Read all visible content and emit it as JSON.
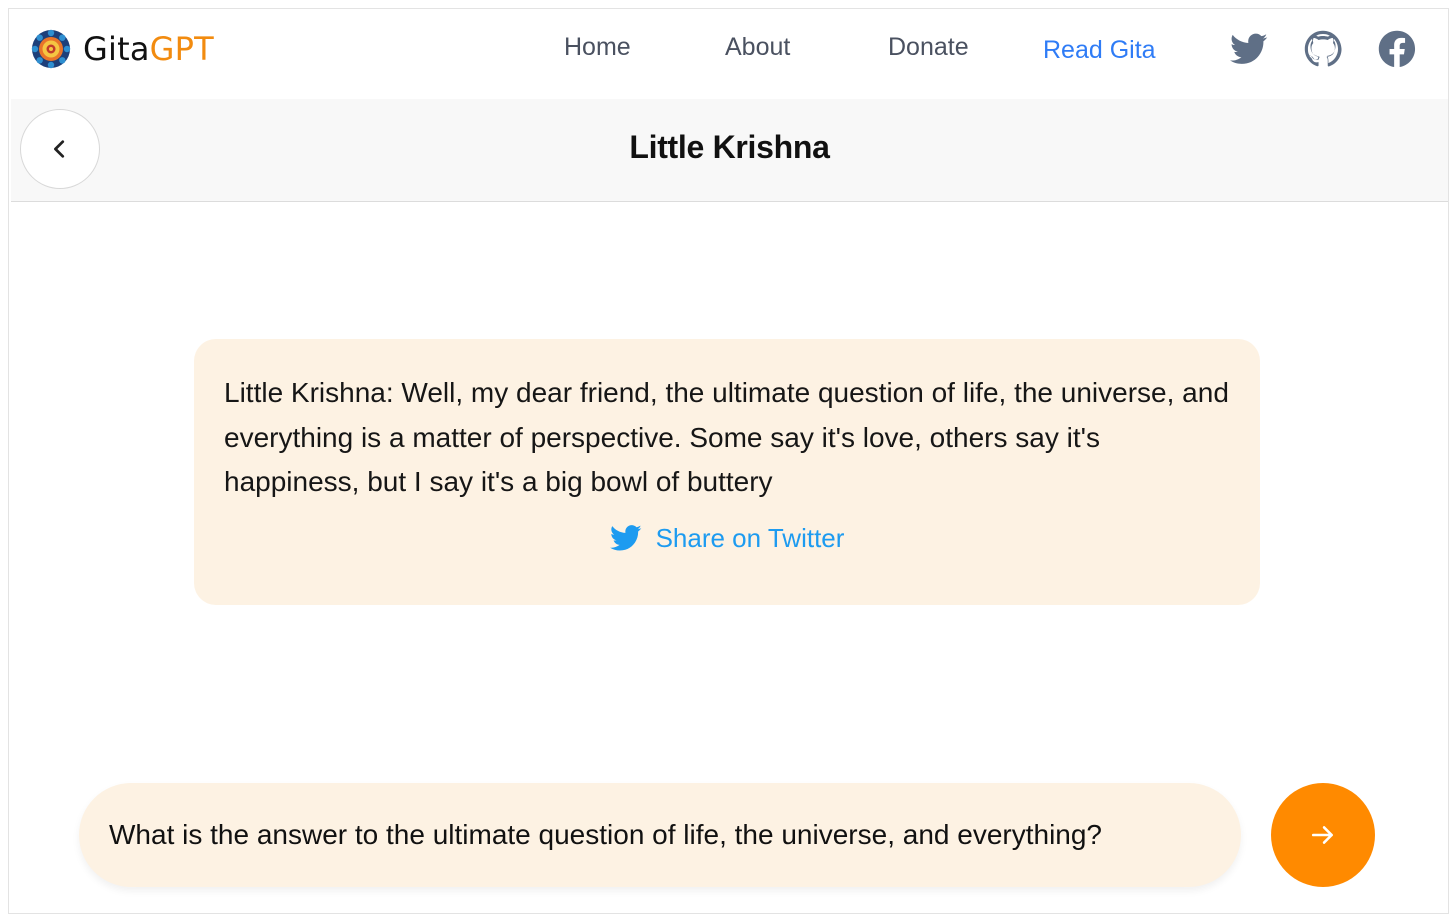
{
  "header": {
    "brand_main": "Gita",
    "brand_accent": "GPT",
    "logo_icon": "mandala-icon",
    "nav": [
      {
        "label": "Home"
      },
      {
        "label": "About"
      },
      {
        "label": "Donate"
      },
      {
        "label": "Read Gita",
        "active": true
      }
    ],
    "social": [
      "twitter-icon",
      "github-icon",
      "facebook-icon"
    ]
  },
  "chat": {
    "title": "Little Krishna",
    "back_icon": "chevron-left-icon",
    "response": "Little Krishna: Well, my dear friend, the ultimate question of life, the universe, and everything is a matter of perspective. Some say it's love, others say it's happiness, but I say it's a big bowl of buttery",
    "share_label": "Share on Twitter"
  },
  "input": {
    "value": "What is the answer to the ultimate question of life, the universe, and everything?",
    "send_icon": "arrow-right-icon"
  },
  "colors": {
    "accent_orange": "#ff8a00",
    "brand_orange": "#f28b0f",
    "link_blue": "#2f7cf6",
    "twitter_blue": "#1d9bf0",
    "card_bg": "#fdf2e3",
    "icon_gray": "#5f6f86"
  }
}
